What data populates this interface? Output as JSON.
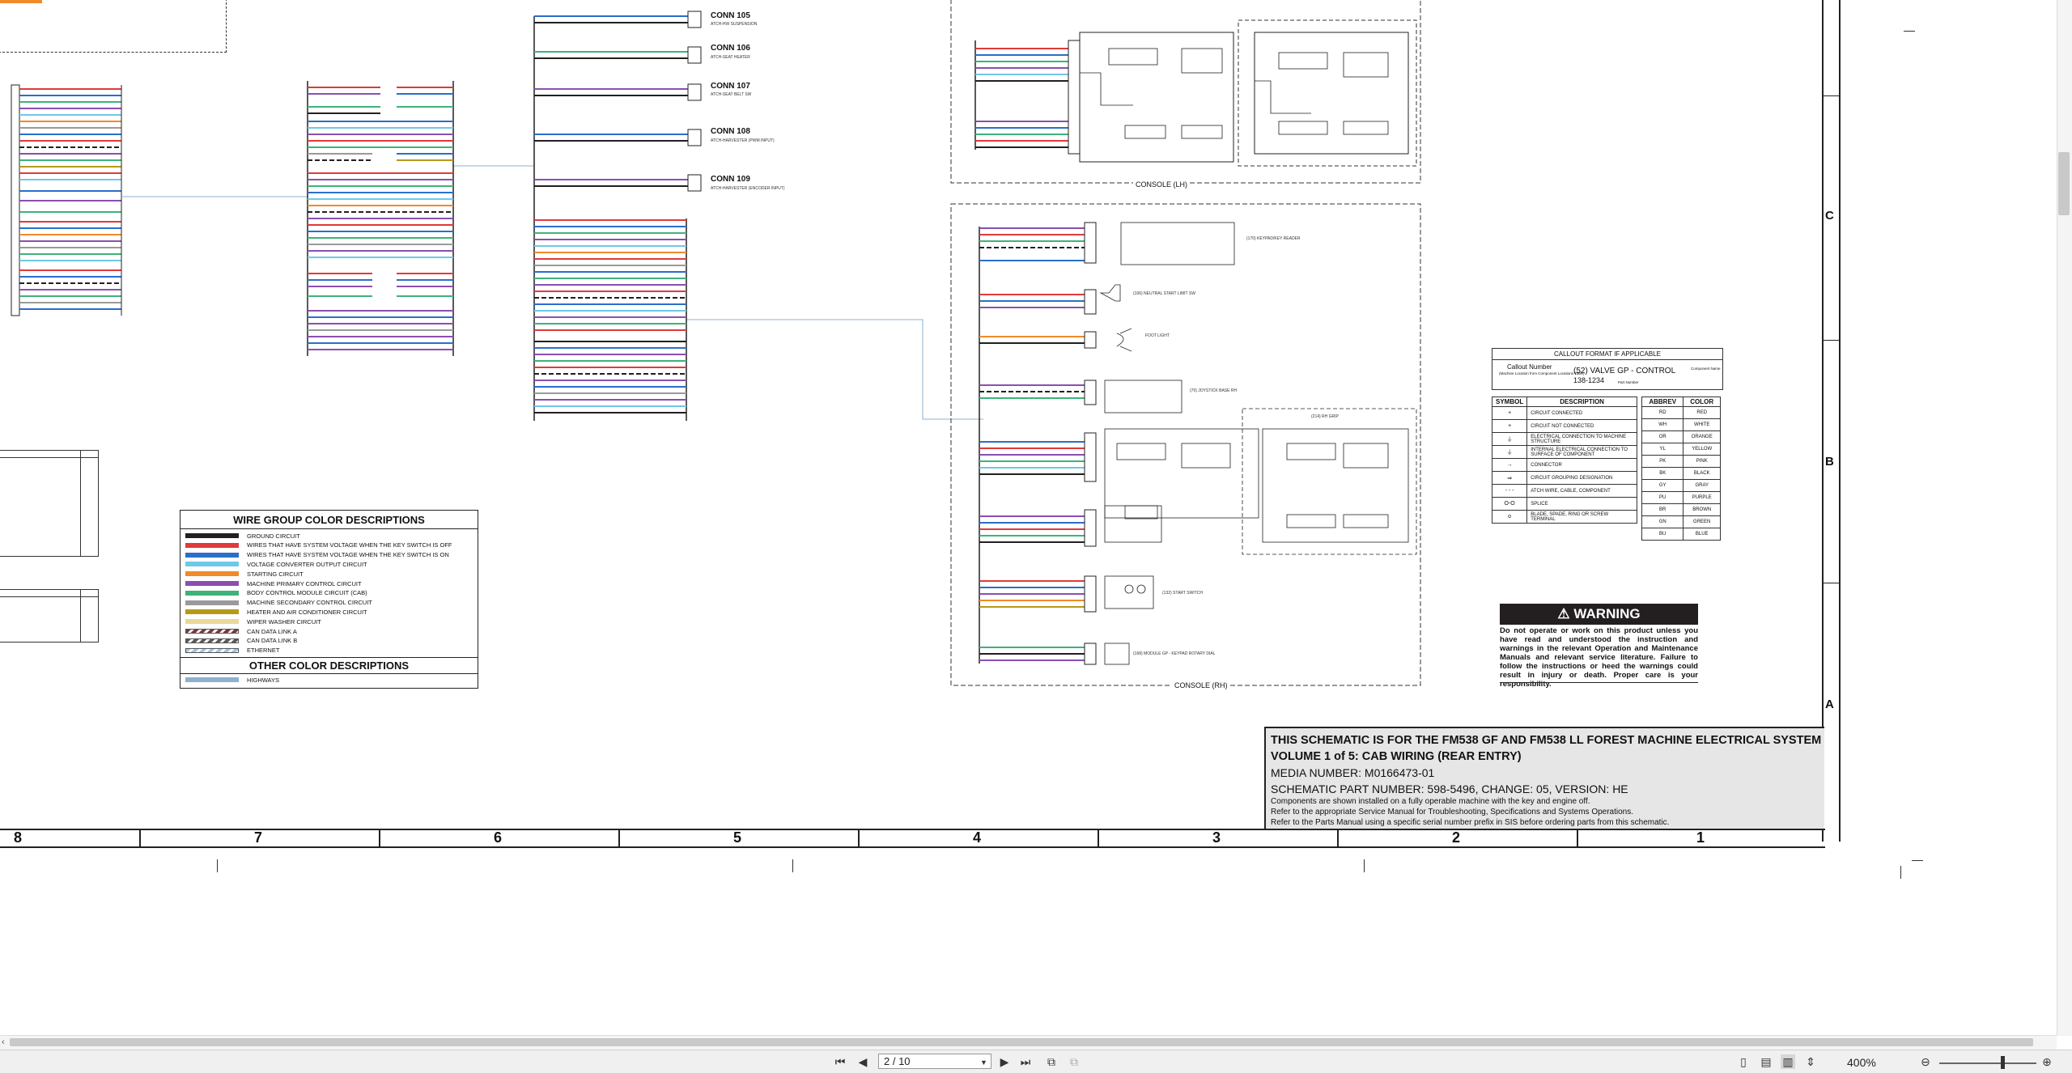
{
  "viewer": {
    "page_current": "2 / 10",
    "zoom": "400%"
  },
  "zones": {
    "columns": [
      "8",
      "7",
      "6",
      "5",
      "4",
      "3",
      "2",
      "1"
    ],
    "rows": [
      "C",
      "B",
      "A"
    ]
  },
  "connectors": [
    {
      "label": "CONN 105",
      "desc": "ATCH-HW SUSPENSION"
    },
    {
      "label": "CONN 106",
      "desc": "ATCH-SEAT HEATER"
    },
    {
      "label": "CONN 107",
      "desc": "ATCH-SEAT BELT SW"
    },
    {
      "label": "CONN 108",
      "desc": "ATCH-HARVESTER (PWM INPUT)"
    },
    {
      "label": "CONN 109",
      "desc": "ATCH-HARVESTER (ENCODER INPUT)"
    }
  ],
  "consoles": {
    "lh": "CONSOLE (LH)",
    "rh": "CONSOLE (RH)"
  },
  "components_rh": [
    "(170) KEYPAD/KEY READER",
    "(106) NEUTRAL START LIMIT SW",
    "FOOT LIGHT",
    "(70) JOYSTICK BASE RH",
    "(214) RH GRIP",
    "(132) START SWITCH",
    "(168) MODULE GP - KEYPAD ROTARY DIAL"
  ],
  "wire_legend": {
    "title": "WIRE GROUP COLOR DESCRIPTIONS",
    "items": [
      {
        "color": "#231f20",
        "label": "GROUND CIRCUIT"
      },
      {
        "color": "#e03a3a",
        "label": "WIRES THAT HAVE SYSTEM VOLTAGE WHEN THE KEY SWITCH IS OFF"
      },
      {
        "color": "#2a6fc9",
        "label": "WIRES THAT HAVE SYSTEM VOLTAGE WHEN THE KEY SWITCH IS ON"
      },
      {
        "color": "#6fc8e8",
        "label": "VOLTAGE CONVERTER OUTPUT CIRCUIT"
      },
      {
        "color": "#f08a2a",
        "label": "STARTING CIRCUIT"
      },
      {
        "color": "#8a4fb0",
        "label": "MACHINE PRIMARY CONTROL CIRCUIT"
      },
      {
        "color": "#3fb27a",
        "label": "BODY CONTROL MODULE CIRCUIT (CAB)"
      },
      {
        "color": "#9a9a9a",
        "label": "MACHINE SECONDARY CONTROL CIRCUIT"
      },
      {
        "color": "#b59a1a",
        "label": "HEATER AND AIR CONDITIONER CIRCUIT"
      },
      {
        "color": "#e8d89a",
        "label": "WIPER WASHER CIRCUIT"
      },
      {
        "color": "#7a3a3a",
        "label": "CAN DATA LINK A"
      },
      {
        "color": "#5a5a5a",
        "label": "CAN DATA LINK B"
      },
      {
        "color": "#9fc6e6",
        "label": "ETHERNET"
      }
    ],
    "other_title": "OTHER COLOR DESCRIPTIONS",
    "other_items": [
      {
        "color": "#8fb0cf",
        "label": "HIGHWAYS"
      }
    ]
  },
  "callout": {
    "title": "CALLOUT FORMAT IF APPLICABLE",
    "callout_number": "Callout Number",
    "callout_sub": "(Machine Location from Component Locations Table)",
    "example": "(52) VALVE GP - CONTROL",
    "part": "138-1234",
    "component_name": "Component Name",
    "part_number": "Part Number"
  },
  "symbols": {
    "header_symbol": "SYMBOL",
    "header_desc": "DESCRIPTION",
    "rows": [
      {
        "sym": "+",
        "desc": "CIRCUIT CONNECTED"
      },
      {
        "sym": "+",
        "desc": "CIRCUIT NOT CONNECTED"
      },
      {
        "sym": "⏚",
        "desc": "ELECTRICAL CONNECTION TO MACHINE STRUCTURE"
      },
      {
        "sym": "⏚",
        "desc": "INTERNAL ELECTRICAL CONNECTION TO SURFACE OF COMPONENT"
      },
      {
        "sym": "→",
        "desc": "CONNECTOR"
      },
      {
        "sym": "⇒",
        "desc": "CIRCUIT GROUPING DESIGNATION"
      },
      {
        "sym": "- - -",
        "desc": "ATCH WIRE, CABLE, COMPONENT"
      },
      {
        "sym": "O-O",
        "desc": "SPLICE"
      },
      {
        "sym": "o",
        "desc": "BLADE, SPADE, RING OR SCREW TERMINAL"
      }
    ]
  },
  "colors_table": {
    "header_abbrev": "ABBREV",
    "header_color": "COLOR",
    "rows": [
      {
        "abbrev": "RD",
        "color": "RED"
      },
      {
        "abbrev": "WH",
        "color": "WHITE"
      },
      {
        "abbrev": "OR",
        "color": "ORANGE"
      },
      {
        "abbrev": "YL",
        "color": "YELLOW"
      },
      {
        "abbrev": "PK",
        "color": "PINK"
      },
      {
        "abbrev": "BK",
        "color": "BLACK"
      },
      {
        "abbrev": "GY",
        "color": "GRAY"
      },
      {
        "abbrev": "PU",
        "color": "PURPLE"
      },
      {
        "abbrev": "BR",
        "color": "BROWN"
      },
      {
        "abbrev": "GN",
        "color": "GREEN"
      },
      {
        "abbrev": "BU",
        "color": "BLUE"
      }
    ]
  },
  "warning": {
    "title": "WARNING",
    "text": "Do not operate or work on this product unless you have read and understood the instruction and warnings in the relevant Operation and Maintenance Manuals and relevant service literature. Failure to follow the instructions or heed the warnings could result in injury or death. Proper care is your responsibility."
  },
  "title_block": {
    "line1": "THIS SCHEMATIC IS FOR THE FM538 GF AND FM538 LL FOREST MACHINE ELECTRICAL SYSTEM",
    "line2": "VOLUME 1 of 5: CAB WIRING (REAR ENTRY)",
    "line3": "MEDIA NUMBER: M0166473-01",
    "line4": "SCHEMATIC PART NUMBER: 598-5496, CHANGE: 05, VERSION: HE",
    "note1": "Components are shown installed on a fully operable machine with the key and engine off.",
    "note2": "Refer to the appropriate Service Manual for Troubleshooting, Specifications and Systems Operations.",
    "note3": "Refer to the Parts Manual using a specific serial number prefix in SIS before ordering parts from this schematic."
  }
}
